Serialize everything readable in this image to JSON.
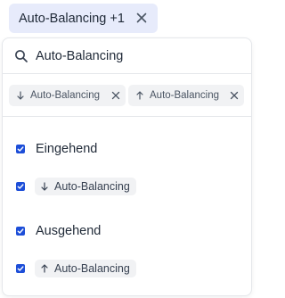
{
  "filter_chip": {
    "label": "Auto-Balancing +1"
  },
  "search": {
    "value": "Auto-Balancing",
    "placeholder": ""
  },
  "selected_tokens": [
    {
      "icon": "arrow-down-icon",
      "label": "Auto-Balancing"
    },
    {
      "icon": "arrow-up-icon",
      "label": "Auto-Balancing"
    }
  ],
  "options": [
    {
      "type": "group",
      "label": "Eingehend",
      "checked": true
    },
    {
      "type": "item",
      "icon": "arrow-down-icon",
      "label": "Auto-Balancing",
      "checked": true
    },
    {
      "type": "group",
      "label": "Ausgehend",
      "checked": true
    },
    {
      "type": "item",
      "icon": "arrow-up-icon",
      "label": "Auto-Balancing",
      "checked": true
    }
  ],
  "colors": {
    "accent": "#1d4ed8",
    "chip_bg": "#e7ebfb",
    "token_bg": "#f1f2f4",
    "border": "#e5e7eb"
  }
}
